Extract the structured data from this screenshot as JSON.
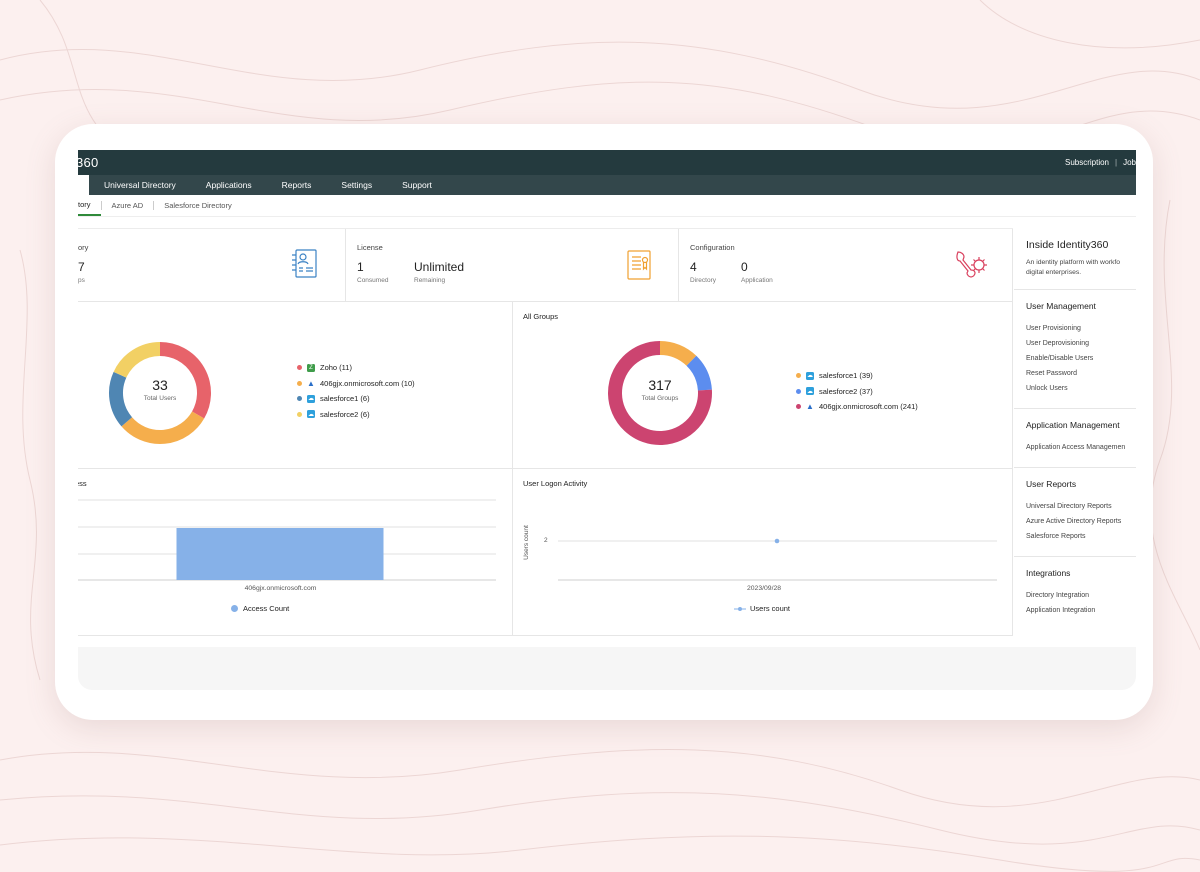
{
  "app": {
    "logo": "360",
    "top_links": [
      "Subscription",
      "Job"
    ]
  },
  "nav": {
    "items": [
      "Universal Directory",
      "Applications",
      "Reports",
      "Settings",
      "Support"
    ]
  },
  "subtabs": [
    "tory",
    "Azure AD",
    "Salesforce Directory"
  ],
  "stats": {
    "directory": {
      "label": "ory",
      "value": "7",
      "sub": "ps"
    },
    "license": {
      "label": "License",
      "consumed_value": "1",
      "consumed_label": "Consumed",
      "remaining_value": "Unlimited",
      "remaining_label": "Remaining"
    },
    "configuration": {
      "label": "Configuration",
      "directory_value": "4",
      "directory_label": "Directory",
      "application_value": "0",
      "application_label": "Application"
    }
  },
  "users_chart": {
    "center_value": "33",
    "center_label": "Total Users",
    "legend": [
      {
        "label": "Zoho (11)",
        "color": "#e7636a",
        "icon": "zoho-icon"
      },
      {
        "label": "406gjx.onmicrosoft.com (10)",
        "color": "#f5ae4c",
        "icon": "azure-icon"
      },
      {
        "label": "salesforce1 (6)",
        "color": "#4f86b3",
        "icon": "salesforce-icon"
      },
      {
        "label": "salesforce2 (6)",
        "color": "#f2d064",
        "icon": "salesforce-icon"
      }
    ]
  },
  "groups_chart": {
    "title": "All Groups",
    "center_value": "317",
    "center_label": "Total Groups",
    "legend": [
      {
        "label": "salesforce1 (39)",
        "color": "#f5ae4c",
        "icon": "salesforce-icon"
      },
      {
        "label": "salesforce2 (37)",
        "color": "#5c8def",
        "icon": "salesforce-icon"
      },
      {
        "label": "406gjx.onmicrosoft.com (241)",
        "color": "#cc4470",
        "icon": "azure-icon"
      }
    ]
  },
  "access_chart": {
    "title": "ess",
    "category": "406gjx.onmicrosoft.com",
    "legend": "Access Count",
    "color": "#86b1e8"
  },
  "logon_chart": {
    "title": "User Logon Activity",
    "ylabel": "Users count",
    "ytick": "2",
    "xtick": "2023/09/28",
    "legend": "Users count",
    "color": "#86b1e8"
  },
  "chart_data": [
    {
      "type": "pie",
      "categories": [
        "Zoho",
        "406gjx.onmicrosoft.com",
        "salesforce1",
        "salesforce2"
      ],
      "values": [
        11,
        10,
        6,
        6
      ],
      "colors": [
        "#e7636a",
        "#f5ae4c",
        "#4f86b3",
        "#f2d064"
      ]
    },
    {
      "type": "pie",
      "title": "All Groups",
      "categories": [
        "salesforce1",
        "salesforce2",
        "406gjx.onmicrosoft.com"
      ],
      "values": [
        39,
        37,
        241
      ],
      "colors": [
        "#f5ae4c",
        "#5c8def",
        "#cc4470"
      ]
    },
    {
      "type": "bar",
      "categories": [
        "406gjx.onmicrosoft.com"
      ],
      "series": [
        {
          "name": "Access Count",
          "values": [
            3
          ]
        }
      ]
    },
    {
      "type": "line",
      "title": "User Logon Activity",
      "ylabel": "Users count",
      "x": [
        "2023/09/28"
      ],
      "series": [
        {
          "name": "Users count",
          "values": [
            2
          ]
        }
      ]
    }
  ],
  "sidebar": {
    "title": "Inside Identity360",
    "desc_line1": "An identity platform with workfo",
    "desc_line2": "digital enterprises.",
    "sections": [
      {
        "title": "User Management",
        "links": [
          "User Provisioning",
          "User Deprovisioning",
          "Enable/Disable Users",
          "Reset Password",
          "Unlock Users"
        ]
      },
      {
        "title": "Application Management",
        "links": [
          "Application Access Managemen"
        ]
      },
      {
        "title": "User Reports",
        "links": [
          "Universal Directory Reports",
          "Azure Active Directory Reports",
          "Salesforce Reports"
        ]
      },
      {
        "title": "Integrations",
        "links": [
          "Directory Integration",
          "Application Integration"
        ]
      }
    ]
  }
}
